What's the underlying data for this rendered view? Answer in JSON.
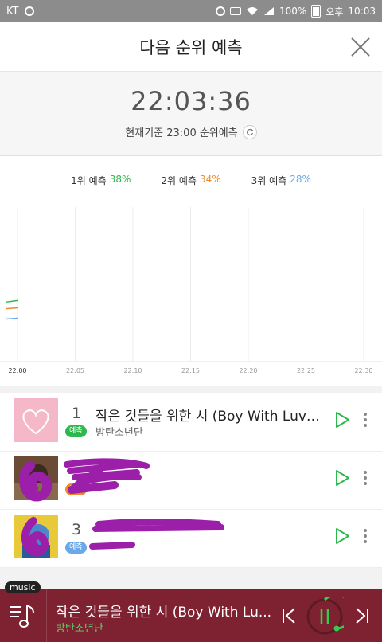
{
  "status_bar": {
    "carrier": "KT",
    "battery": "100%",
    "time_prefix": "오후",
    "time": "10:03"
  },
  "header": {
    "title": "다음 순위 예측"
  },
  "clock": {
    "time": "22:03:36",
    "basis": "현재기준 23:00 순위예측"
  },
  "legend": [
    {
      "label": "1위 예측",
      "value": "38%",
      "color": "#2db84d"
    },
    {
      "label": "2위 예측",
      "value": "34%",
      "color": "#f0892a"
    },
    {
      "label": "3위 예측",
      "value": "28%",
      "color": "#6aa8e8"
    }
  ],
  "chart_data": {
    "type": "line",
    "x": [
      "22:00",
      "22:05",
      "22:10",
      "22:15",
      "22:20",
      "22:25",
      "22:30"
    ],
    "series": [
      {
        "color": "#2db84d",
        "points": [
          [
            "21:59",
            38.5
          ],
          [
            "22:00",
            39.5
          ]
        ]
      },
      {
        "color": "#f0892a",
        "points": [
          [
            "21:59",
            34.2
          ],
          [
            "22:00",
            34.8
          ]
        ]
      },
      {
        "color": "#6aa8e8",
        "points": [
          [
            "21:59",
            27.6
          ],
          [
            "22:00",
            28.1
          ]
        ]
      }
    ],
    "grid": true
  },
  "list": [
    {
      "rank": "1",
      "title": "작은 것들을 위한 시 (Boy With Luv) f...",
      "badge": "예측",
      "badge_color": "#2db84d",
      "artist": "방탄소년단"
    },
    {
      "rank": "",
      "title": "",
      "badge": "예측",
      "badge_color": "#f0892a",
      "artist": ""
    },
    {
      "rank": "3",
      "title": "",
      "badge": "예측",
      "badge_color": "#6aa8e8",
      "artist": ""
    }
  ],
  "player": {
    "tag": "music",
    "title": "작은 것들을 위한 시 (Boy With Lu...",
    "artist": "방탄소년단"
  }
}
